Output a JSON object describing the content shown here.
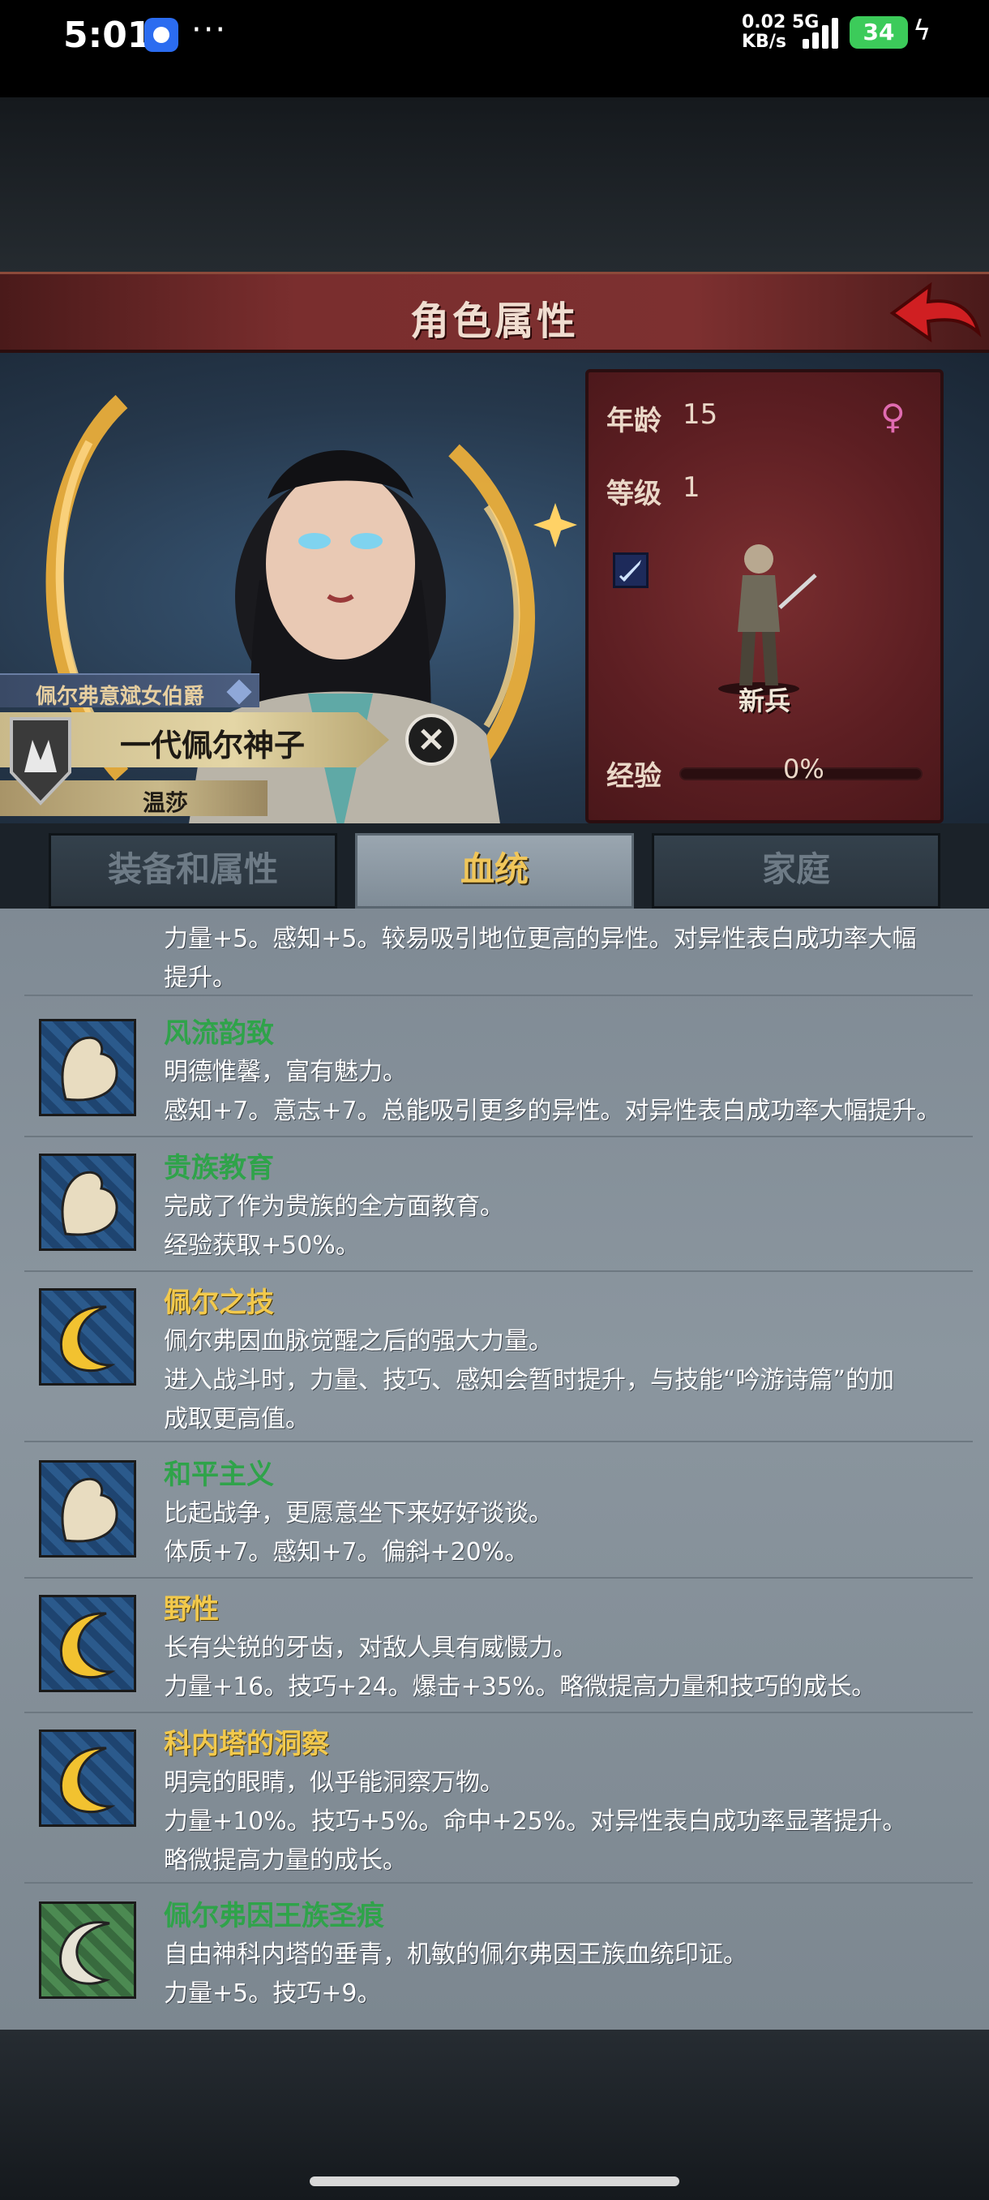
{
  "status_bar": {
    "time": "5:01",
    "more": "···",
    "net_speed": "0.02",
    "net_unit": "KB/s",
    "net_type": "5G",
    "battery": "34"
  },
  "header": {
    "title": "角色属性"
  },
  "character": {
    "title_rank": "佩尔弗意斌女伯爵",
    "name": "一代佩尔神子",
    "given_name": "温莎",
    "remove_symbol": "×"
  },
  "stats": {
    "age_label": "年龄",
    "age_value": "15",
    "level_label": "等级",
    "level_value": "1",
    "unit_name": "新兵",
    "exp_label": "经验",
    "exp_value": "0%",
    "exp_progress": 0
  },
  "tabs": [
    {
      "label": "装备和属性",
      "active": false
    },
    {
      "label": "血统",
      "active": true
    },
    {
      "label": "家庭",
      "active": false
    }
  ],
  "traits": [
    {
      "name": "",
      "icon": "arm-icon",
      "lines": [
        "力量+5。感知+5。较易吸引地位更高的异性。对异性表白成功率大幅",
        "提升。"
      ]
    },
    {
      "name": "风流韵致",
      "gold": false,
      "icon": "arm-icon",
      "lines": [
        "明德惟馨，富有魅力。",
        "感知+7。意志+7。总能吸引更多的异性。对异性表白成功率大幅提升。"
      ]
    },
    {
      "name": "贵族教育",
      "gold": false,
      "icon": "arm-icon",
      "lines": [
        "完成了作为贵族的全方面教育。",
        "经验获取+50%。"
      ]
    },
    {
      "name": "佩尔之技",
      "gold": true,
      "icon": "moon-icon",
      "lines": [
        "佩尔弗因血脉觉醒之后的强大力量。",
        "进入战斗时，力量、技巧、感知会暂时提升，与技能“吟游诗篇”的加",
        "成取更高值。"
      ]
    },
    {
      "name": "和平主义",
      "gold": false,
      "icon": "arm-icon",
      "lines": [
        "比起战争，更愿意坐下来好好谈谈。",
        "体质+7。感知+7。偏斜+20%。"
      ]
    },
    {
      "name": "野性",
      "gold": true,
      "icon": "moon-icon",
      "lines": [
        "长有尖锐的牙齿，对敌人具有威慑力。",
        "力量+16。技巧+24。爆击+35%。略微提高力量和技巧的成长。"
      ]
    },
    {
      "name": "科内塔的洞察",
      "gold": true,
      "icon": "moon-icon",
      "lines": [
        "明亮的眼睛，似乎能洞察万物。",
        "力量+10%。技巧+5%。命中+25%。对异性表白成功率显著提升。",
        "略微提高力量的成长。"
      ]
    },
    {
      "name": "佩尔弗因王族圣痕",
      "gold": false,
      "icon": "crescent-icon",
      "lines": [
        "自由神科内塔的垂青，机敏的佩尔弗因王族血统印证。",
        "力量+5。技巧+9。"
      ]
    }
  ],
  "colors": {
    "title_bar": "#7a2e2e",
    "trait_name_green": "#2fa34a",
    "trait_name_gold": "#f2c94c",
    "tab_active_text": "#f0c65a"
  }
}
